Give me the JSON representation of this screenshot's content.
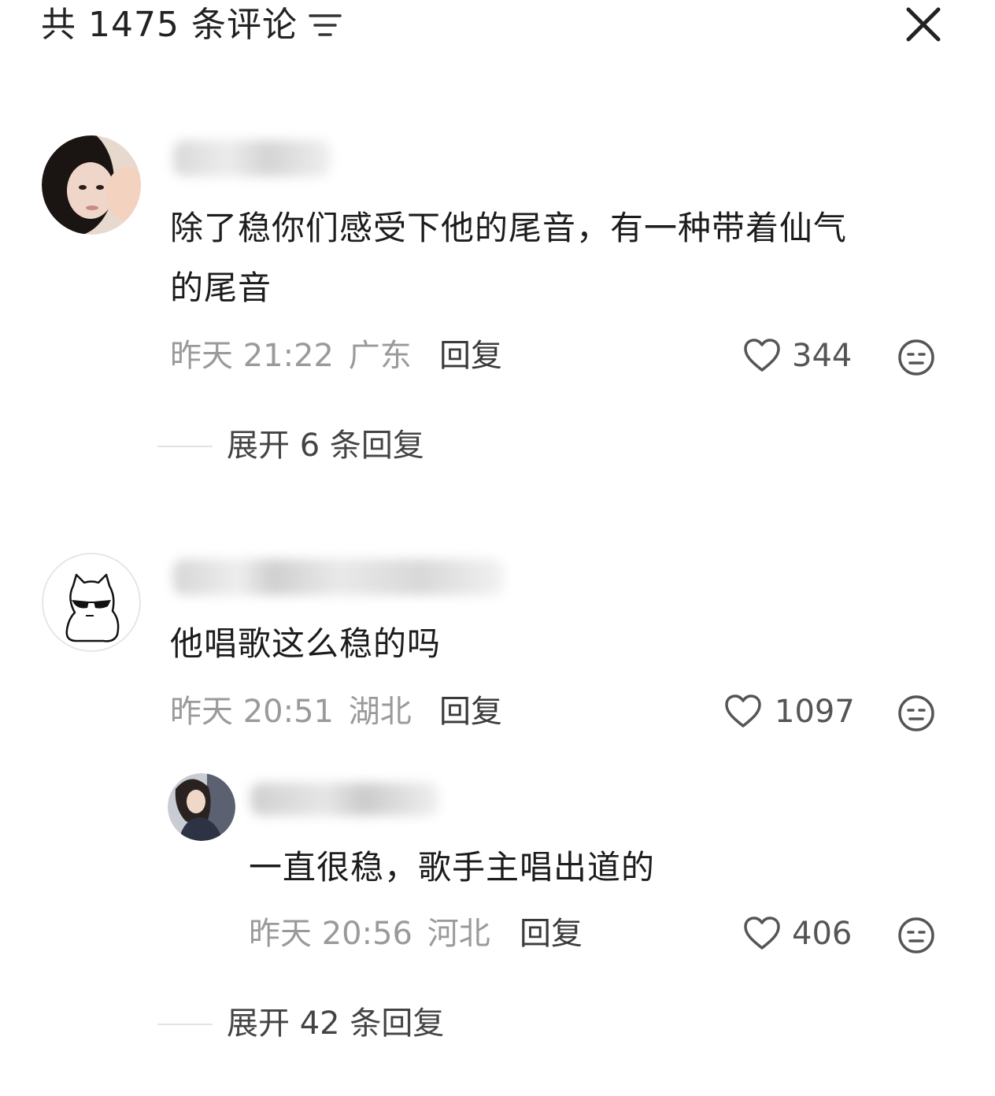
{
  "header": {
    "title": "共 1475 条评论",
    "filter_icon": "filter-icon",
    "close_icon": "close-icon"
  },
  "comments": [
    {
      "text": "除了稳你们感受下他的尾音，有一种带着仙气的尾音",
      "text_line1": "除了稳你们感受下他的尾音，有一种带着仙气",
      "text_line2": "的尾音",
      "time": "昨天 21:22",
      "location": "广东",
      "reply_label": "回复",
      "likes": "344",
      "expand_label": "展开 6 条回复"
    },
    {
      "text": "他唱歌这么稳的吗",
      "time": "昨天 20:51",
      "location": "湖北",
      "reply_label": "回复",
      "likes": "1097",
      "replies": [
        {
          "text": "一直很稳，歌手主唱出道的",
          "time": "昨天 20:56",
          "location": "河北",
          "reply_label": "回复",
          "likes": "406"
        }
      ],
      "expand_label": "展开 42 条回复"
    }
  ],
  "colors": {
    "meta": "#9a9a9a",
    "text": "#1c1c1c",
    "divider": "#e3e3e3"
  }
}
